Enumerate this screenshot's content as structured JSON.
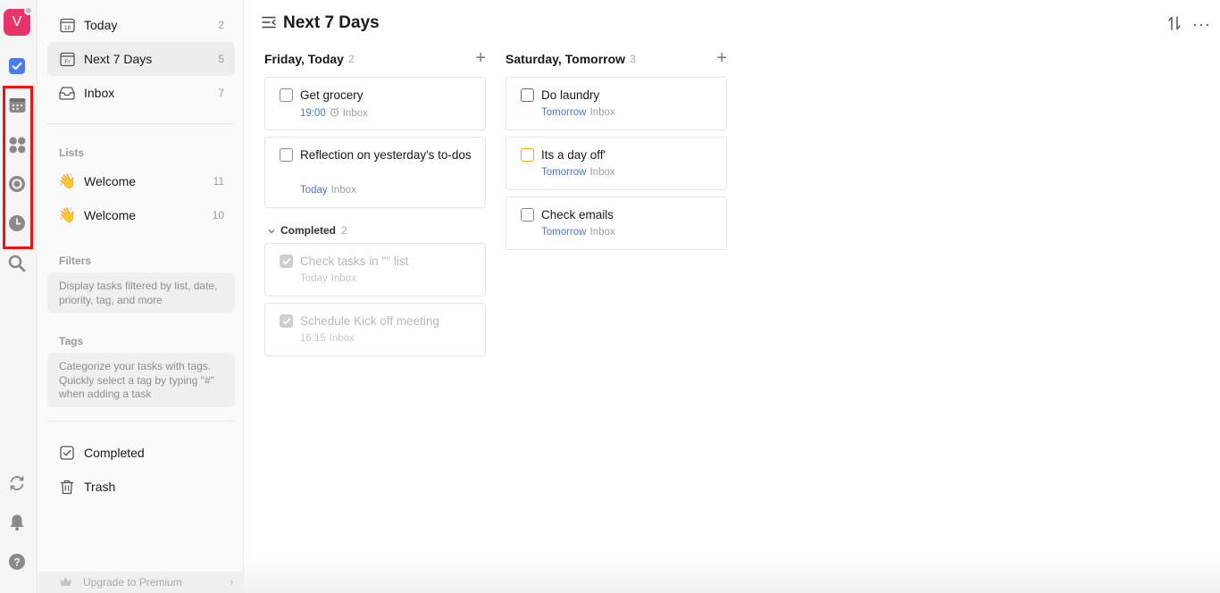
{
  "rail": {
    "avatar_letter": "V",
    "icons": [
      "checkbox-icon",
      "calendar-icon",
      "grid-icon",
      "target-icon",
      "clock-icon",
      "search-icon",
      "sync-icon",
      "bell-icon",
      "help-icon"
    ],
    "highlight_color": "#ee1111"
  },
  "sidebar": {
    "nav": [
      {
        "label": "Today",
        "count": "2",
        "icon": "calendar-18-icon"
      },
      {
        "label": "Next 7 Days",
        "count": "5",
        "icon": "calendar-fr-icon"
      },
      {
        "label": "Inbox",
        "count": "7",
        "icon": "inbox-icon"
      }
    ],
    "lists_label": "Lists",
    "lists": [
      {
        "emoji": "👋",
        "label": "Welcome",
        "count": "11"
      },
      {
        "emoji": "👋",
        "label": "Welcome",
        "count": "10"
      }
    ],
    "filters_label": "Filters",
    "filters_hint": "Display tasks filtered by list, date, priority, tag, and more",
    "tags_label": "Tags",
    "tags_hint": "Categorize your tasks with tags. Quickly select a tag by typing \"#\" when adding a task",
    "completed_label": "Completed",
    "trash_label": "Trash",
    "upgrade_label": "Upgrade to Premium"
  },
  "main": {
    "title": "Next 7 Days",
    "columns": [
      {
        "heading": "Friday, Today",
        "count": "2",
        "tasks": [
          {
            "title": "Get grocery",
            "date": "19:00",
            "list": "Inbox"
          },
          {
            "title": "Reflection on yesterday's to-dos",
            "date": "Today",
            "list": "Inbox"
          }
        ],
        "completed_label": "Completed",
        "completed_count": "2",
        "completed": [
          {
            "title": "Check tasks in \"\" list",
            "date": "Today",
            "list": "Inbox"
          },
          {
            "title": "Schedule Kick off meeting",
            "date": "16:15",
            "list": "Inbox"
          }
        ]
      },
      {
        "heading": "Saturday, Tomorrow",
        "count": "3",
        "tasks": [
          {
            "title": "Do laundry",
            "date": "Tomorrow",
            "list": "Inbox",
            "priority_color": "#e0373a"
          },
          {
            "title": "Its a day off'",
            "date": "Tomorrow",
            "list": "Inbox",
            "priority_color": "#f0a822"
          },
          {
            "title": "Check emails",
            "date": "Tomorrow",
            "list": "Inbox"
          }
        ]
      }
    ]
  }
}
